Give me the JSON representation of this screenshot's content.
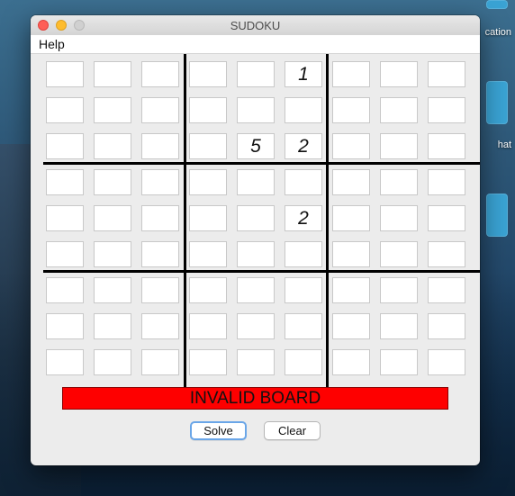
{
  "desktop": {
    "labels": [
      "cation",
      "hat"
    ]
  },
  "window": {
    "title": "SUDOKU"
  },
  "menu": {
    "items": [
      "Help"
    ]
  },
  "board": {
    "cells": [
      [
        "",
        "",
        "",
        "",
        "",
        "1",
        "",
        "",
        ""
      ],
      [
        "",
        "",
        "",
        "",
        "",
        "",
        "",
        "",
        ""
      ],
      [
        "",
        "",
        "",
        "",
        "5",
        "2",
        "",
        "",
        ""
      ],
      [
        "",
        "",
        "",
        "",
        "",
        "",
        "",
        "",
        ""
      ],
      [
        "",
        "",
        "",
        "",
        "",
        "2",
        "",
        "",
        ""
      ],
      [
        "",
        "",
        "",
        "",
        "",
        "",
        "",
        "",
        ""
      ],
      [
        "",
        "",
        "",
        "",
        "",
        "",
        "",
        "",
        ""
      ],
      [
        "",
        "",
        "",
        "",
        "",
        "",
        "",
        "",
        ""
      ],
      [
        "",
        "",
        "",
        "",
        "",
        "",
        "",
        "",
        ""
      ]
    ]
  },
  "status": {
    "text": "INVALID BOARD",
    "color": "#fe0000"
  },
  "buttons": {
    "solve": "Solve",
    "clear": "Clear"
  }
}
